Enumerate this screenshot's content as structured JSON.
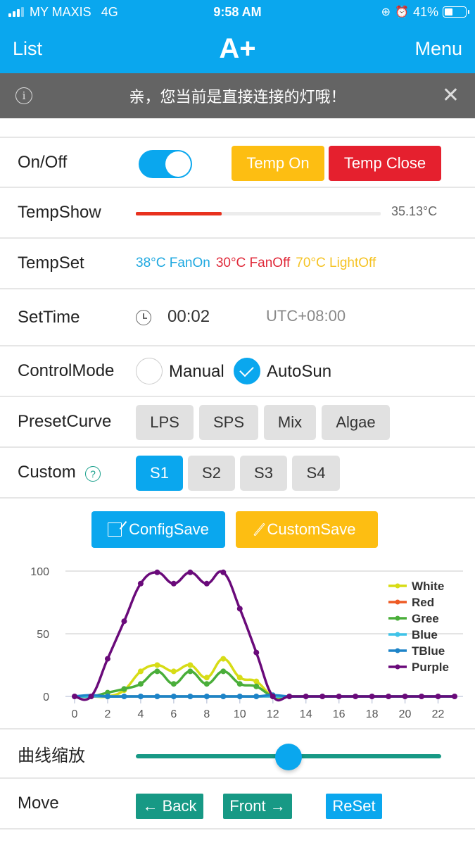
{
  "status_bar": {
    "carrier": "MY MAXIS",
    "network": "4G",
    "time": "9:58 AM",
    "icons": [
      "signal-icon",
      "orientation-lock-icon",
      "alarm-icon",
      "battery-icon"
    ],
    "battery_percent": "41%",
    "battery_level": 0.41
  },
  "nav": {
    "left": "List",
    "title": "A+",
    "right": "Menu"
  },
  "notice": {
    "text": "亲，您当前是直接连接的灯哦！",
    "info_icon": "ⓘ",
    "close_icon": "✕"
  },
  "onoff": {
    "label": "On/Off",
    "toggle_on": true,
    "temp_on_label": "Temp On",
    "temp_close_label": "Temp Close"
  },
  "tempshow": {
    "label": "TempShow",
    "value": "35.13°C",
    "bar_fraction": 0.35
  },
  "tempset": {
    "label": "TempSet",
    "items": [
      {
        "text": "38°C FanOn",
        "color": "#1ea8e0"
      },
      {
        "text": "30°C FanOff",
        "color": "#e02a3a"
      },
      {
        "text": "70°C LightOff",
        "color": "#f5c324"
      }
    ]
  },
  "settime": {
    "label": "SetTime",
    "time": "00:02",
    "timezone": "UTC+08:00"
  },
  "controlmode": {
    "label": "ControlMode",
    "options": [
      {
        "label": "Manual",
        "checked": false
      },
      {
        "label": "AutoSun",
        "checked": true
      }
    ]
  },
  "presetcurve": {
    "label": "PresetCurve",
    "options": [
      "LPS",
      "SPS",
      "Mix",
      "Algae"
    ]
  },
  "custom": {
    "label": "Custom",
    "help_icon": "?",
    "options": [
      "S1",
      "S2",
      "S3",
      "S4"
    ],
    "active": "S1"
  },
  "save": {
    "config_label": "ConfigSave",
    "custom_label": "CustomSave"
  },
  "chart_data": {
    "type": "line",
    "title": "",
    "xlabel": "",
    "ylabel": "",
    "x": [
      0,
      1,
      2,
      3,
      4,
      5,
      6,
      7,
      8,
      9,
      10,
      11,
      12,
      13,
      14,
      15,
      16,
      17,
      18,
      19,
      20,
      21,
      22,
      23
    ],
    "xticks": [
      0,
      2,
      4,
      6,
      8,
      10,
      12,
      14,
      16,
      18,
      20,
      22
    ],
    "yticks": [
      0,
      50,
      100
    ],
    "ylim": [
      0,
      100
    ],
    "xlim": [
      0,
      23
    ],
    "grid": true,
    "legend_position": "top-right",
    "series": [
      {
        "name": "White",
        "color": "#d7dc16",
        "values": [
          0,
          0,
          0,
          5,
          20,
          25,
          20,
          25,
          15,
          30,
          15,
          12,
          0,
          0,
          0,
          0,
          0,
          0,
          0,
          0,
          0,
          0,
          0,
          0
        ]
      },
      {
        "name": "Red",
        "color": "#ee5a24",
        "values": [
          0,
          0,
          0,
          0,
          0,
          0,
          0,
          0,
          0,
          0,
          0,
          0,
          0,
          0,
          0,
          0,
          0,
          0,
          0,
          0,
          0,
          0,
          0,
          0
        ]
      },
      {
        "name": "Gree",
        "color": "#4aae3a",
        "values": [
          0,
          0,
          3,
          6,
          10,
          20,
          10,
          20,
          10,
          20,
          10,
          8,
          0,
          0,
          0,
          0,
          0,
          0,
          0,
          0,
          0,
          0,
          0,
          0
        ]
      },
      {
        "name": "Blue",
        "color": "#3fc3e8",
        "values": [
          0,
          0,
          0,
          0,
          0,
          0,
          0,
          0,
          0,
          0,
          0,
          0,
          0,
          0,
          0,
          0,
          0,
          0,
          0,
          0,
          0,
          0,
          0,
          0
        ]
      },
      {
        "name": "TBlue",
        "color": "#1d84c8",
        "values": [
          0,
          1,
          0,
          0,
          0,
          0,
          0,
          0,
          0,
          0,
          0,
          0,
          1,
          0,
          0,
          0,
          0,
          0,
          0,
          0,
          0,
          0,
          0,
          0
        ]
      },
      {
        "name": "Purple",
        "color": "#6a0a7a",
        "values": [
          0,
          0,
          30,
          60,
          90,
          99,
          90,
          99,
          90,
          99,
          70,
          35,
          0,
          0,
          0,
          0,
          0,
          0,
          0,
          0,
          0,
          0,
          0,
          0
        ]
      }
    ]
  },
  "zoom": {
    "label": "曲线缩放",
    "value_fraction": 0.5
  },
  "move": {
    "label": "Move",
    "back_label": "← Back",
    "front_label": "Front →",
    "reset_label": "ReSet"
  }
}
